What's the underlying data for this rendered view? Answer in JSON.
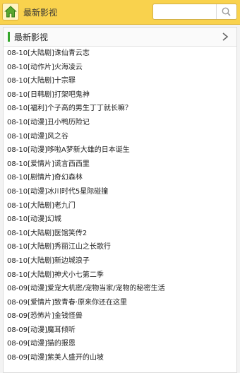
{
  "header": {
    "title": "最新影视",
    "search_placeholder": "",
    "search_value": ""
  },
  "section": {
    "title": "最新影视"
  },
  "items": [
    {
      "date": "08-10",
      "label": "[大陆剧]诛仙青云志"
    },
    {
      "date": "08-10",
      "label": "[动作片]火海凌云"
    },
    {
      "date": "08-10",
      "label": "[大陆剧]十宗罪"
    },
    {
      "date": "08-10",
      "label": "[日韩剧]打架吧鬼神"
    },
    {
      "date": "08-10",
      "label": "[福利]个子高的男生丁丁就长嘛？"
    },
    {
      "date": "08-10",
      "label": "[动漫]丑小鸭历险记"
    },
    {
      "date": "08-10",
      "label": "[动漫]风之谷"
    },
    {
      "date": "08-10",
      "label": "[动漫]哆啦A梦新大雄的日本诞生"
    },
    {
      "date": "08-10",
      "label": "[爱情片]谎言西西里"
    },
    {
      "date": "08-10",
      "label": "[剧情片]奇幻森林"
    },
    {
      "date": "08-10",
      "label": "[动漫]冰川时代5星际碰撞"
    },
    {
      "date": "08-10",
      "label": "[大陆剧]老九门"
    },
    {
      "date": "08-10",
      "label": "[动漫]幻城"
    },
    {
      "date": "08-10",
      "label": "[大陆剧]医馆笑传2"
    },
    {
      "date": "08-10",
      "label": "[大陆剧]秀丽江山之长歌行"
    },
    {
      "date": "08-10",
      "label": "[大陆剧]新边城浪子"
    },
    {
      "date": "08-10",
      "label": "[大陆剧]神犬小七第二季"
    },
    {
      "date": "08-09",
      "label": "[动漫]爱宠大机密/宠物当家/宠物的秘密生活"
    },
    {
      "date": "08-09",
      "label": "[爱情片]致青春·原来你还在这里"
    },
    {
      "date": "08-09",
      "label": "[恐怖片]金钱怪兽"
    },
    {
      "date": "08-09",
      "label": "[动漫]魔耳倾听"
    },
    {
      "date": "08-09",
      "label": "[动漫]猫的报恩"
    },
    {
      "date": "08-09",
      "label": "[动漫]紫美人盛开的山坡"
    }
  ]
}
